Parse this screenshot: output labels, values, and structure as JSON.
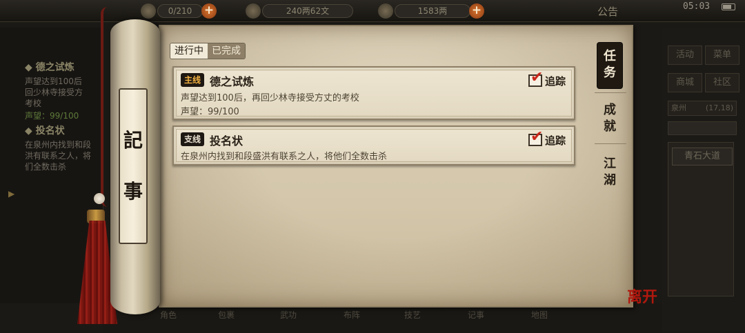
{
  "hud": {
    "currency_1": "0/210",
    "currency_2": "240两62文",
    "currency_3": "1583两",
    "notice": "公告",
    "time": "05:03"
  },
  "side_panel": {
    "quest1_title": "◆ 德之试炼",
    "quest1_line1": "声望达到100后",
    "quest1_line2": "回少林寺接受方",
    "quest1_line3": "考校",
    "quest1_progress": "声望：99/100",
    "quest2_title": "◆ 投名状",
    "quest2_line1": "在泉州内找到和段",
    "quest2_line2": "洪有联系之人，将",
    "quest2_line3": "们全数击杀"
  },
  "right_menu": {
    "btn1": "活动",
    "btn2": "菜单",
    "btn3": "商城",
    "btn4": "社区",
    "location": "泉州",
    "coords": "(17,18)",
    "map_label": "青石大道"
  },
  "bottom_menu": [
    "角色",
    "包裹",
    "武功",
    "布阵",
    "技艺",
    "记事",
    "地图"
  ],
  "scroll": {
    "rod_char_1": "記",
    "rod_char_2": "事"
  },
  "status_tabs": {
    "in_progress": "进行中",
    "completed": "已完成"
  },
  "quests": [
    {
      "badge": "主线",
      "title": "德之试炼",
      "desc": "声望达到100后，再回少林寺接受方丈的考校",
      "progress": "声望：99/100",
      "track_label": "追踪",
      "tracked": true
    },
    {
      "badge": "支线",
      "title": "投名状",
      "desc": "在泉州内找到和段盛洪有联系之人，将他们全数击杀",
      "track_label": "追踪",
      "tracked": true
    }
  ],
  "categories": [
    {
      "label_1": "任",
      "label_2": "务",
      "active": true
    },
    {
      "label_1": "成",
      "label_2": "就",
      "active": false
    },
    {
      "label_1": "江",
      "label_2": "湖",
      "active": false
    }
  ],
  "leave_label": "离开",
  "colors": {
    "accent_red": "#c8281c",
    "paper": "#ddd2ba",
    "main_badge": "#f0b040"
  }
}
